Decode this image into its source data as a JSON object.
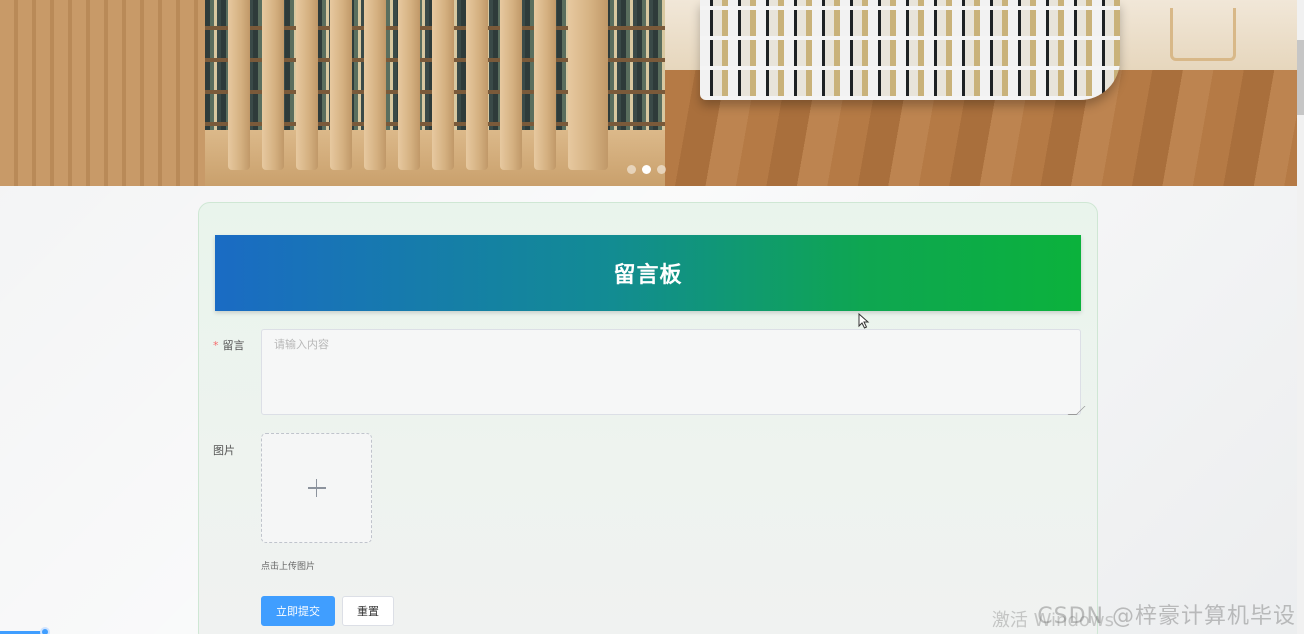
{
  "banner": {
    "slides_total": 3,
    "active_slide": 2
  },
  "message_board": {
    "title": "留言板",
    "message_label": "留言",
    "message_required_mark": "*",
    "message_placeholder": "请输入内容",
    "image_label": "图片",
    "upload_tip": "点击上传图片",
    "submit_label": "立即提交",
    "reset_label": "重置"
  },
  "overlay": {
    "watermark": "CSDN @梓豪计算机毕设",
    "activate_windows": "激活 Windows"
  },
  "colors": {
    "primary": "#409eff",
    "title_gradient_start": "#1a6bc4",
    "title_gradient_end": "#0bb23c",
    "required": "#f56c6c"
  },
  "icons": {
    "upload": "plus-icon",
    "cursor": "mouse-pointer-icon"
  }
}
